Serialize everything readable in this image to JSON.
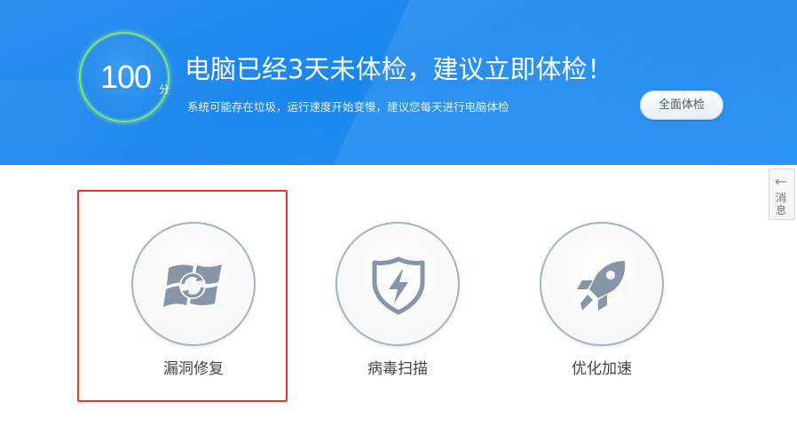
{
  "banner": {
    "score": "100",
    "score_unit": "分",
    "headline": "电脑已经3天未体检，建议立即体检！",
    "subline": "系统可能存在垃圾，运行速度开始变慢，建议您每天进行电脑体检",
    "check_button": "全面体检"
  },
  "message_tab": {
    "label": "消息",
    "icon": "arrow-left-icon"
  },
  "tools": [
    {
      "label": "漏洞修复",
      "icon": "windows-repair-icon",
      "selected": true
    },
    {
      "label": "病毒扫描",
      "icon": "shield-lightning-icon",
      "selected": false
    },
    {
      "label": "优化加速",
      "icon": "rocket-icon",
      "selected": false
    }
  ],
  "colors": {
    "banner": "#1a86ee",
    "score_ring": "#7fe86c",
    "icon": "#8795a6",
    "selection": "#e03a2e"
  }
}
